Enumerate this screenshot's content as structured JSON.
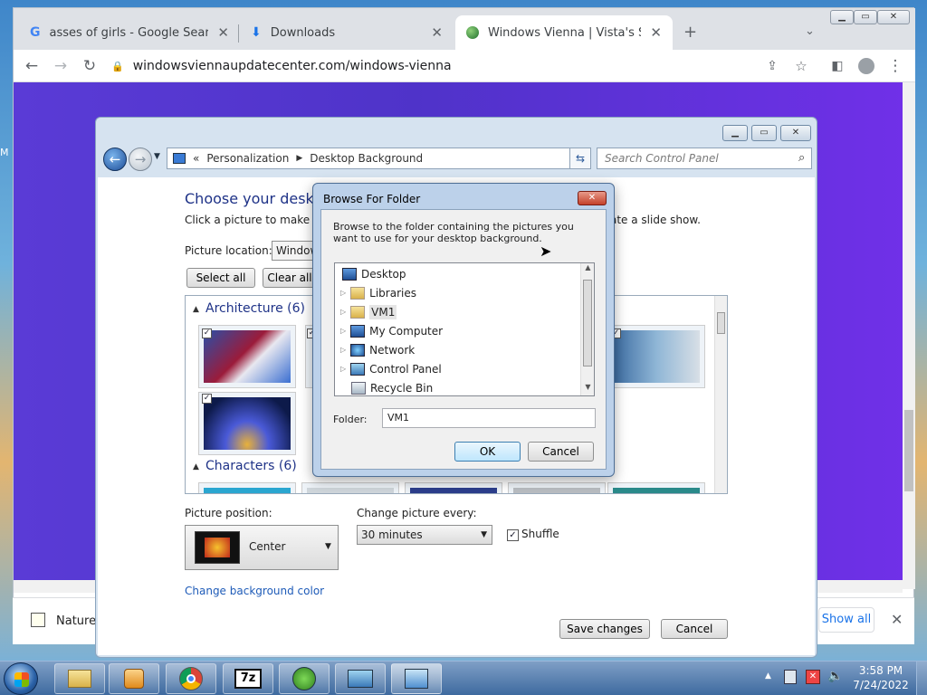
{
  "browser": {
    "tabs": [
      {
        "title": "asses of girls - Google Search",
        "icon": "google-icon"
      },
      {
        "title": "Downloads",
        "icon": "download-icon"
      },
      {
        "title": "Windows Vienna | Vista's Site",
        "icon": "globe-icon",
        "active": true
      }
    ],
    "url": "windowsviennaupdatecenter.com/windows-vienna"
  },
  "cp": {
    "breadcrumb": [
      "Personalization",
      "Desktop Background"
    ],
    "search_placeholder": "Search Control Panel",
    "heading": "Choose your desktop",
    "instruction": "Click a picture to make it y",
    "instruction_right": "ate a slide show.",
    "picture_location_label": "Picture location:",
    "picture_location_value": "Window",
    "select_all": "Select all",
    "clear_all": "Clear all",
    "groups": [
      {
        "name": "Architecture (6)"
      },
      {
        "name": "Characters (6)"
      }
    ],
    "picture_position_label": "Picture position:",
    "picture_position_value": "Center",
    "change_every_label": "Change picture every:",
    "change_every_value": "30 minutes",
    "shuffle_label": "Shuffle",
    "bg_color_link": "Change background color",
    "save_changes": "Save changes",
    "cancel": "Cancel"
  },
  "dialog": {
    "title": "Browse For Folder",
    "description": "Browse to the folder containing the pictures you want to use for your desktop background.",
    "tree": [
      "Desktop",
      "Libraries",
      "VM1",
      "My Computer",
      "Network",
      "Control Panel",
      "Recycle Bin"
    ],
    "selected": "VM1",
    "folder_label": "Folder:",
    "folder_value": "VM1",
    "ok": "OK",
    "cancel": "Cancel"
  },
  "download_bar": {
    "item": "Nature",
    "show_all": "Show all"
  },
  "desktop_edge_text": "M",
  "taskbar": {
    "time": "3:58 PM",
    "date": "7/24/2022"
  }
}
